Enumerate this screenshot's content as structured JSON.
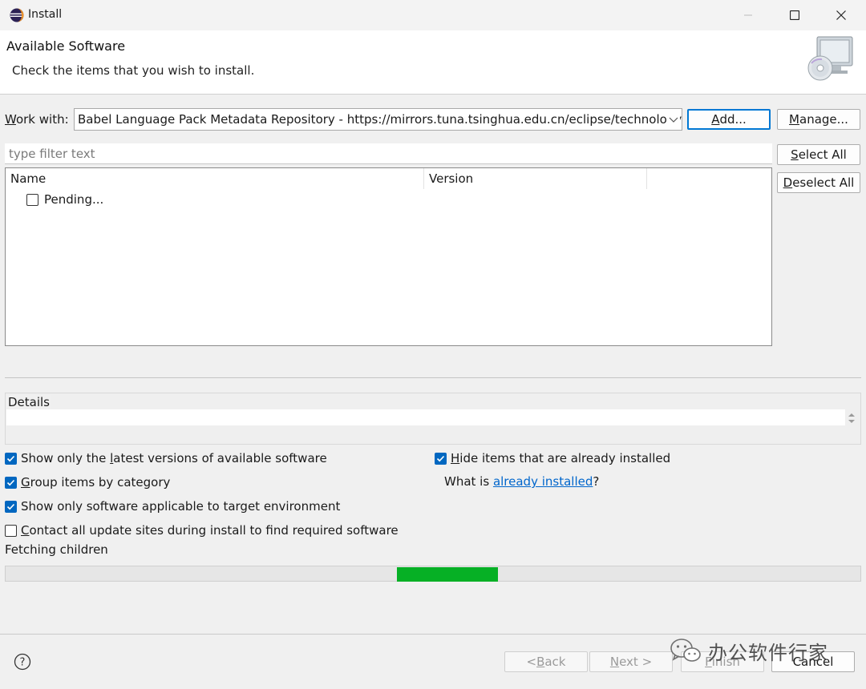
{
  "window": {
    "title": "Install",
    "controls": {
      "minimize_icon": "minimize-icon",
      "maximize_icon": "maximize-icon",
      "close_icon": "close-icon"
    }
  },
  "banner": {
    "title": "Available Software",
    "description": "Check the items that you wish to install."
  },
  "work_with": {
    "label_prefix": "W",
    "label_rest": "ork with:",
    "value": "Babel Language Pack Metadata Repository - https://mirrors.tuna.tsinghua.edu.cn/eclipse/technology/",
    "add_button": {
      "mnemonic": "A",
      "rest": "dd..."
    },
    "manage_button": {
      "mnemonic": "M",
      "rest": "anage..."
    }
  },
  "filter": {
    "placeholder": "type filter text"
  },
  "buttons": {
    "select_all": {
      "mnemonic": "S",
      "rest": "elect All"
    },
    "deselect_all": {
      "mnemonic": "D",
      "rest": "eselect All"
    }
  },
  "table": {
    "columns": [
      "Name",
      "Version"
    ],
    "rows": [
      {
        "label": "Pending...",
        "checked": false
      }
    ]
  },
  "details": {
    "label": "Details",
    "text": ""
  },
  "options": {
    "latest": {
      "checked": true,
      "pre": "Show only the ",
      "mnemonic": "l",
      "post": "atest versions of available software"
    },
    "group": {
      "checked": true,
      "pre": "",
      "mnemonic": "G",
      "post": "roup items by category"
    },
    "applicable": {
      "checked": true,
      "text": "Show only software applicable to target environment"
    },
    "contact": {
      "checked": false,
      "pre": "",
      "mnemonic": "C",
      "post": "ontact all update sites during install to find required software"
    },
    "hide_installed": {
      "checked": true,
      "pre": "",
      "mnemonic": "H",
      "post": "ide items that are already installed"
    },
    "what_is": {
      "prefix": "What is ",
      "link": "already installed",
      "suffix": "?"
    }
  },
  "status": {
    "text": "Fetching children",
    "progress_segment_start": 0.458,
    "progress_segment_end": 0.576,
    "progress_color": "#06b025"
  },
  "footer": {
    "help_icon": "help-icon",
    "back": {
      "pre": "< ",
      "mnemonic": "B",
      "rest": "ack"
    },
    "next": {
      "mnemonic": "N",
      "rest": "ext >"
    },
    "finish": {
      "mnemonic": "F",
      "rest": "inish"
    },
    "cancel": "Cancel"
  },
  "watermark": {
    "text": "办公软件行家",
    "icon": "wechat-icon"
  },
  "colors": {
    "accent": "#0078d4",
    "checkbox": "#0067c0",
    "link": "#0066cc"
  }
}
